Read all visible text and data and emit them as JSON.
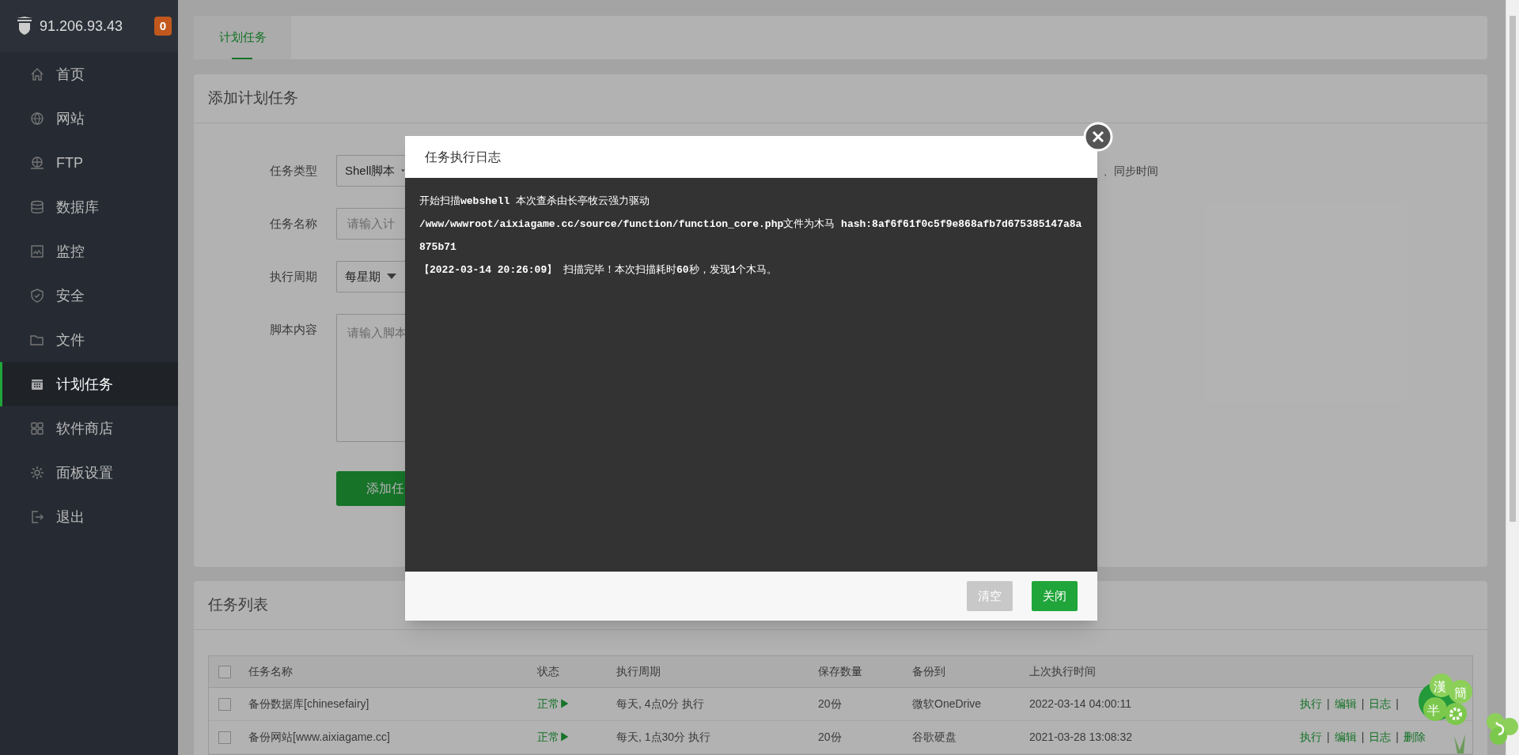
{
  "sidebar": {
    "host": "91.206.93.43",
    "badge": "0",
    "items": [
      {
        "label": "首页",
        "selected": false
      },
      {
        "label": "网站",
        "selected": false
      },
      {
        "label": "FTP",
        "selected": false
      },
      {
        "label": "数据库",
        "selected": false
      },
      {
        "label": "监控",
        "selected": false
      },
      {
        "label": "安全",
        "selected": false
      },
      {
        "label": "文件",
        "selected": false
      },
      {
        "label": "计划任务",
        "selected": true
      },
      {
        "label": "软件商店",
        "selected": false
      },
      {
        "label": "面板设置",
        "selected": false
      },
      {
        "label": "退出",
        "selected": false
      }
    ]
  },
  "tabs": [
    {
      "label": "计划任务",
      "selected": true
    }
  ],
  "form": {
    "title": "添加计划任务",
    "fields": [
      {
        "label": "任务类型",
        "kind": "select",
        "value": "Shell脚本"
      },
      {
        "label": "任务名称",
        "kind": "input",
        "placeholder": "请输入计"
      },
      {
        "label": "执行周期",
        "kind": "select",
        "value": "每星期"
      },
      {
        "label": "脚本内容",
        "kind": "textarea",
        "placeholder": "请输入脚本"
      }
    ],
    "hint": "、同步时间",
    "submit": "添加任"
  },
  "modal": {
    "title": "任务执行日志",
    "log_lines": [
      "开始扫描**webshell** 本次查杀由长亭牧云强力驱动",
      "**/www/wwwroot/aixiagame.cc/source/function/function_core.php**文件为木马  **hash:8af6f61f0c5f9e868afb7d675385147a8a875b71**",
      "【**2022-03-14 20:26:09**】 扫描完毕！本次扫描耗时**60**秒，发现**1**个木马。"
    ],
    "buttons": [
      {
        "label": "清空",
        "kind": "secondary"
      },
      {
        "label": "关闭",
        "kind": "primary"
      }
    ]
  },
  "task_list": {
    "title": "任务列表",
    "all_checked": false,
    "columns": [
      "任务名称",
      "状态",
      "执行周期",
      "保存数量",
      "备份到",
      "上次执行时间"
    ],
    "rows": [
      {
        "checked": false,
        "cells": [
          "备份数据库[chinesefairy]",
          "正常▶",
          "每天, 4点0分 执行",
          "20份",
          "微软OneDrive",
          "2022-03-14 04:00:11"
        ],
        "actions": [
          {
            "kind": "link",
            "label": "执行"
          },
          {
            "kind": "sep",
            "label": "|"
          },
          {
            "kind": "link",
            "label": "编辑"
          },
          {
            "kind": "sep",
            "label": "|"
          },
          {
            "kind": "link",
            "label": "日志"
          },
          {
            "kind": "sep",
            "label": "|"
          }
        ]
      },
      {
        "checked": false,
        "cells": [
          "备份网站[www.aixiagame.cc]",
          "正常▶",
          "每天, 1点30分 执行",
          "20份",
          "谷歌硬盘",
          "2021-03-28 13:08:32"
        ],
        "actions": [
          {
            "kind": "link",
            "label": "执行"
          },
          {
            "kind": "sep",
            "label": "|"
          },
          {
            "kind": "link",
            "label": "编辑"
          },
          {
            "kind": "sep",
            "label": "|"
          },
          {
            "kind": "link",
            "label": "日志"
          },
          {
            "kind": "sep",
            "label": "|"
          },
          {
            "kind": "link",
            "label": "删除"
          }
        ]
      }
    ]
  },
  "widget": {
    "chars": [
      "漢",
      "簡",
      "半"
    ]
  }
}
